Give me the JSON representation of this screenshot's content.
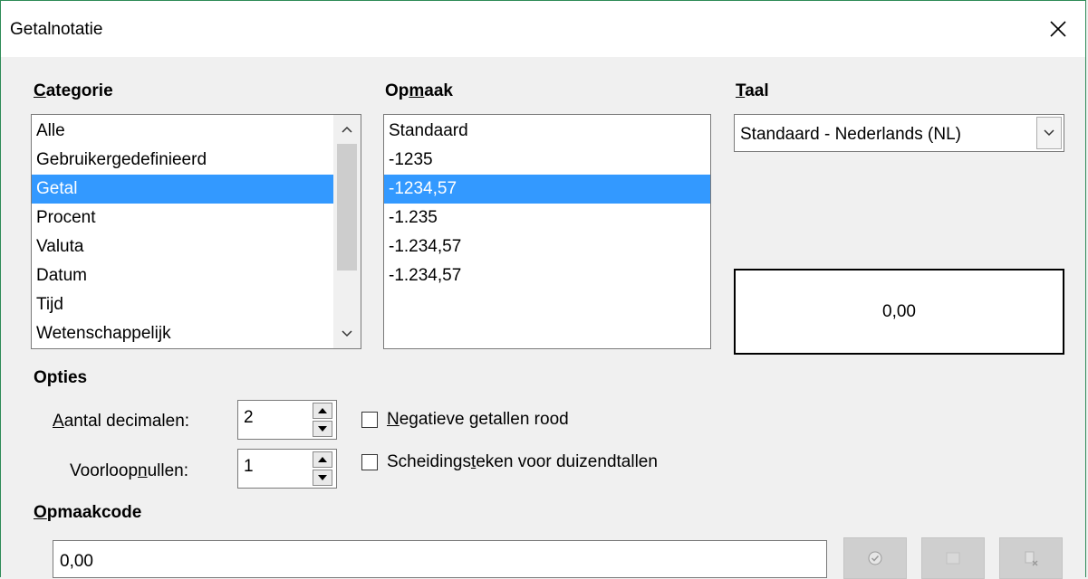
{
  "window": {
    "title": "Getalnotatie"
  },
  "category": {
    "label_prefix": "",
    "label_access": "C",
    "label_rest": "ategorie",
    "items": [
      "Alle",
      "Gebruikergedefinieerd",
      "Getal",
      "Procent",
      "Valuta",
      "Datum",
      "Tijd",
      "Wetenschappelijk"
    ],
    "selected": "Getal"
  },
  "format": {
    "label_prefix": "Op",
    "label_access": "m",
    "label_rest": "aak",
    "items": [
      "Standaard",
      "-1235",
      "-1234,57",
      "-1.235",
      "-1.234,57",
      "-1.234,57"
    ],
    "selected_index": 2
  },
  "language": {
    "label_prefix": "",
    "label_access": "T",
    "label_rest": "aal",
    "value": "Standaard - Nederlands (NL)"
  },
  "preview": {
    "value": "0,00"
  },
  "options": {
    "heading": "Opties",
    "decimals_label_prefix": "",
    "decimals_label_access": "A",
    "decimals_label_rest": "antal decimalen:",
    "decimals_value": "2",
    "leading_zeros_label_prefix": "Voorloop",
    "leading_zeros_label_access": "n",
    "leading_zeros_label_rest": "ullen:",
    "leading_zeros_value": "1",
    "negative_red_prefix": "",
    "negative_red_access": "N",
    "negative_red_rest": "egatieve getallen rood",
    "negative_red_checked": false,
    "thousands_prefix": "Scheidings",
    "thousands_access": "t",
    "thousands_rest": "eken voor duizendtallen",
    "thousands_checked": false
  },
  "format_code": {
    "label_prefix": "",
    "label_access": "O",
    "label_rest": "pmaakcode",
    "value": "0,00"
  },
  "colors": {
    "selection": "#3399ff",
    "frame": "#2e8b57"
  }
}
